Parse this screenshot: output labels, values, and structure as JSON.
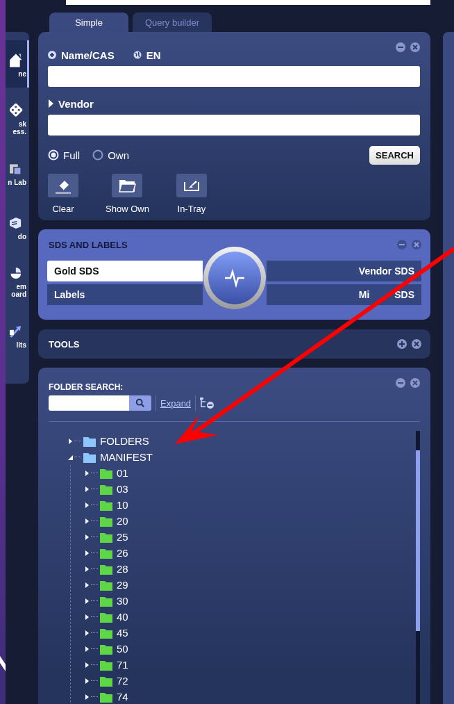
{
  "sidebar": {
    "items": [
      {
        "label": "ne",
        "selected": true
      },
      {
        "label": "sk\ness.",
        "selected": false
      },
      {
        "label": "n Lab",
        "selected": false
      },
      {
        "label": "do",
        "selected": false
      },
      {
        "label": "em\noard",
        "selected": false
      },
      {
        "label": "lits",
        "selected": false
      }
    ]
  },
  "tabs": [
    {
      "label": "Simple",
      "selected": true
    },
    {
      "label": "Query builder",
      "selected": false
    }
  ],
  "search_panel": {
    "name_label": "Name/CAS",
    "language": "EN",
    "vendor_label": "Vendor",
    "vendor_expanded": false,
    "scope": [
      {
        "label": "Full",
        "selected": true
      },
      {
        "label": "Own",
        "selected": false
      }
    ],
    "search_button": "SEARCH",
    "actions": [
      {
        "label": "Clear"
      },
      {
        "label": "Show Own"
      },
      {
        "label": "In-Tray"
      }
    ]
  },
  "sds_panel": {
    "title": "SDS AND LABELS",
    "items": [
      {
        "label": "Gold SDS",
        "selected": true
      },
      {
        "label": "Vendor SDS",
        "selected": false
      },
      {
        "label": "Labels",
        "selected": false
      },
      {
        "label": "Mi SDS",
        "selected": false
      }
    ]
  },
  "tools_panel": {
    "title": "TOOLS",
    "expanded": false
  },
  "folder_panel": {
    "title": "FOLDER SEARCH:",
    "expand_link": "Expand",
    "tree": [
      {
        "label": "FOLDERS",
        "color": "#8ec5fb",
        "expanded": false
      },
      {
        "label": "MANIFEST",
        "color": "#8ec5fb",
        "expanded": true,
        "children": [
          {
            "label": "01",
            "color": "#5fd646",
            "expanded": false
          },
          {
            "label": "03",
            "color": "#5fd646",
            "expanded": false
          },
          {
            "label": "10",
            "color": "#5fd646",
            "expanded": false
          },
          {
            "label": "20",
            "color": "#5fd646",
            "expanded": false
          },
          {
            "label": "25",
            "color": "#5fd646",
            "expanded": false
          },
          {
            "label": "26",
            "color": "#5fd646",
            "expanded": false
          },
          {
            "label": "28",
            "color": "#5fd646",
            "expanded": false
          },
          {
            "label": "29",
            "color": "#5fd646",
            "expanded": false
          },
          {
            "label": "30",
            "color": "#5fd646",
            "expanded": false
          },
          {
            "label": "40",
            "color": "#5fd646",
            "expanded": false
          },
          {
            "label": "45",
            "color": "#5fd646",
            "expanded": false
          },
          {
            "label": "50",
            "color": "#5fd646",
            "expanded": false
          },
          {
            "label": "71",
            "color": "#5fd646",
            "expanded": false
          },
          {
            "label": "72",
            "color": "#5fd646",
            "expanded": false
          },
          {
            "label": "74",
            "color": "#5fd646",
            "expanded": false
          }
        ]
      }
    ]
  }
}
